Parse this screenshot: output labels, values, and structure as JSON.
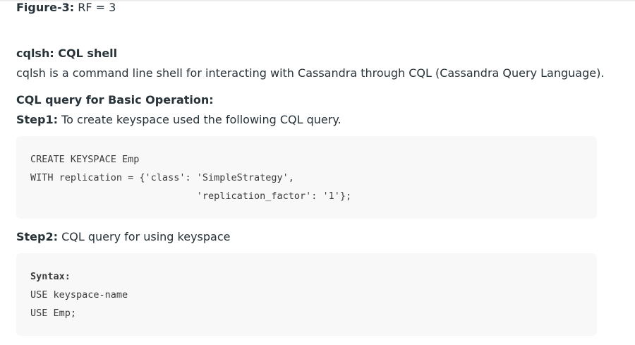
{
  "figure_caption": {
    "label": "Figure-3:",
    "text": " RF = 3"
  },
  "cqlsh_heading": "cqlsh: CQL shell",
  "cqlsh_description": "cqlsh is a command line shell for interacting with Cassandra through CQL (Cassandra Query Language).",
  "basic_operation_heading": "CQL query for Basic Operation:",
  "step1": {
    "label": "Step1:",
    "text": " To create keyspace used the following CQL query."
  },
  "code1": {
    "lines": [
      "CREATE KEYSPACE Emp",
      "WITH replication = {'class': 'SimpleStrategy',",
      "                             'replication_factor': '1'};"
    ]
  },
  "step2": {
    "label": "Step2:",
    "text": " CQL query for using keyspace"
  },
  "code2": {
    "heading": "Syntax:",
    "lines": [
      "USE keyspace-name",
      "USE Emp;"
    ]
  }
}
